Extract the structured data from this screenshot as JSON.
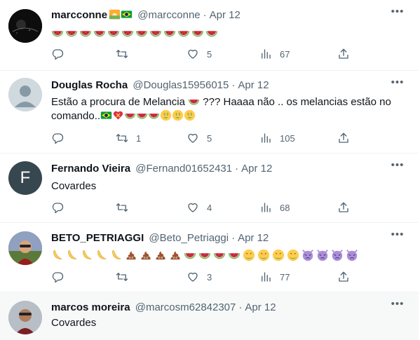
{
  "colors": {
    "text": "#0f1419",
    "secondary": "#536471",
    "divider": "#eff3f4",
    "hover_bg": "#f7f9f9"
  },
  "icons": [
    "reply-icon",
    "retweet-icon",
    "like-icon",
    "views-icon",
    "share-icon",
    "more-icon"
  ],
  "tweets": [
    {
      "name": "marcconne",
      "name_emoji": [
        "sunrise-icon",
        "brazil-flag-icon"
      ],
      "handle": "@marcconne",
      "dot": "·",
      "time": "Apr 12",
      "text": "",
      "emoji_line": [
        "watermelon",
        "watermelon",
        "watermelon",
        "watermelon",
        "watermelon",
        "watermelon",
        "watermelon",
        "watermelon",
        "watermelon",
        "watermelon",
        "watermelon",
        "watermelon"
      ],
      "reply_count": "",
      "retweet_count": "",
      "like_count": "5",
      "view_count": "67"
    },
    {
      "name": "Douglas Rocha",
      "handle": "@Douglas15956015",
      "dot": "·",
      "time": "Apr 12",
      "text_part1": "Estão a procura de Melancia ",
      "text_part2": " ??? Haaaa não .. os melancias estão no",
      "text_line2": "comando..",
      "emoji_line2": [
        "brazil-flag",
        "heart-ribbon",
        "watermelon",
        "watermelon",
        "watermelon",
        "money-face",
        "money-face",
        "money-face"
      ],
      "reply_count": "",
      "retweet_count": "1",
      "like_count": "5",
      "view_count": "105"
    },
    {
      "name": "Fernando Vieira",
      "handle": "@Fernand01652431",
      "dot": "·",
      "time": "Apr 12",
      "avatar_letter": "F",
      "text": "Covardes",
      "reply_count": "",
      "retweet_count": "",
      "like_count": "4",
      "view_count": "68"
    },
    {
      "name": "BETO_PETRIAGGI",
      "handle": "@Beto_Petriaggi",
      "dot": "·",
      "time": "Apr 12",
      "emoji_line": [
        "banana",
        "banana",
        "banana",
        "banana",
        "banana",
        "poop",
        "poop",
        "poop",
        "poop",
        "watermelon",
        "watermelon",
        "watermelon",
        "watermelon",
        "nauseated",
        "nauseated",
        "nauseated",
        "nauseated",
        "angry-devil",
        "angry-devil",
        "angry-devil",
        "angry-devil"
      ],
      "reply_count": "",
      "retweet_count": "",
      "like_count": "3",
      "view_count": "77"
    },
    {
      "name": "marcos moreira",
      "handle": "@marcosm62842307",
      "dot": "·",
      "time": "Apr 12",
      "text": "Covardes"
    }
  ]
}
